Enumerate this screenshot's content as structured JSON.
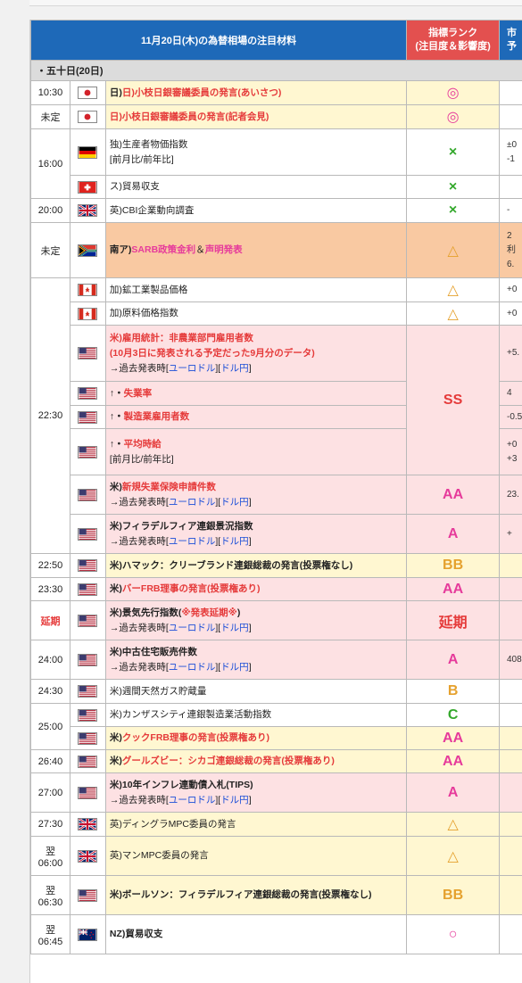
{
  "header": {
    "title": "11月20日(木)の為替相場の注目材料",
    "rank_line1": "指標ランク",
    "rank_line2": "(注目度＆影響度)",
    "forecast_line1": "市",
    "forecast_line2": "予"
  },
  "date_row": "・五十日(20日)",
  "rows": [
    {
      "time": "10:30",
      "flag": "jp-flag-icon",
      "lines": [
        "日)小枝日銀審議委員の発言(あいさつ)"
      ],
      "rank": "◎",
      "fc": [
        ""
      ]
    },
    {
      "time": "未定",
      "flag": "jp-flag-icon",
      "lines": [
        "日)小枝日銀審議委員の発言(記者会見)"
      ],
      "rank": "◎",
      "fc": [
        ""
      ]
    },
    {
      "time": "16:00",
      "flag": "de-flag-icon",
      "lines": [
        "独)生産者物価指数",
        "[前月比/前年比]"
      ],
      "rank": "×",
      "fc": [
        "±0",
        "-1"
      ]
    },
    {
      "time": "",
      "flag": "ch-flag-icon",
      "lines": [
        "ス)貿易収支"
      ],
      "rank": "×",
      "fc": [
        ""
      ]
    },
    {
      "time": "20:00",
      "flag": "uk-flag-icon",
      "lines": [
        "英)CBI企業動向調査"
      ],
      "rank": "×",
      "fc": [
        "-"
      ]
    },
    {
      "time": "未定",
      "flag": "za-flag-icon",
      "lines": [
        "南ア)",
        "SARB政策金利",
        "＆",
        "声明発表"
      ],
      "rank": "△",
      "fc": [
        "2",
        "利",
        "6."
      ]
    },
    {
      "time": "22:30",
      "flag": "ca-flag-icon",
      "lines": [
        "加)鉱工業製品価格"
      ],
      "rank": "△",
      "fc": [
        "+0"
      ]
    },
    {
      "time": "",
      "flag": "ca-flag-icon",
      "lines": [
        "加)原料価格指数"
      ],
      "rank": "△",
      "fc": [
        "+0"
      ]
    },
    {
      "time": "",
      "flag": "us-flag-icon",
      "lines": [
        "米)雇用統計：非農業部門雇用者数",
        "(10月3日に発表される予定だった9月分のデータ)",
        "→過去発表時[",
        "ユーロドル",
        "][",
        "ドル円",
        "]"
      ],
      "rank": "SS",
      "fc": [
        "+5."
      ]
    },
    {
      "time": "",
      "flag": "us-flag-icon",
      "lines": [
        "↑・",
        "失業率"
      ],
      "rank": "",
      "fc": [
        "4"
      ]
    },
    {
      "time": "",
      "flag": "us-flag-icon",
      "lines": [
        "↑・",
        "製造業雇用者数"
      ],
      "rank": "",
      "fc": [
        "-0.5"
      ]
    },
    {
      "time": "",
      "flag": "us-flag-icon",
      "lines": [
        "↑・",
        "平均時給",
        "[前月比/前年比]"
      ],
      "rank": "",
      "fc": [
        "+0",
        "+3"
      ]
    },
    {
      "time": "",
      "flag": "us-flag-icon",
      "lines": [
        "米)",
        "新規失業保険申請件数",
        "→過去発表時[",
        "ユーロドル",
        "][",
        "ドル円",
        "]"
      ],
      "rank": "AA",
      "fc": [
        "23."
      ]
    },
    {
      "time": "",
      "flag": "us-flag-icon",
      "lines": [
        "米)フィラデルフィア連銀景況指数",
        "→過去発表時[",
        "ユーロドル",
        "][",
        "ドル円",
        "]"
      ],
      "rank": "A",
      "fc": [
        "+"
      ]
    },
    {
      "time": "22:50",
      "flag": "us-flag-icon",
      "lines": [
        "米)ハマック：クリーブランド連銀総裁の発言(投票権なし)"
      ],
      "rank": "BB",
      "fc": [
        ""
      ]
    },
    {
      "time": "23:30",
      "flag": "us-flag-icon",
      "lines": [
        "米)",
        "バーFRB理事の発言(投票権あり)"
      ],
      "rank": "AA",
      "fc": [
        ""
      ]
    },
    {
      "time": "延期",
      "flag": "us-flag-icon",
      "lines": [
        "米)景気先行指数(",
        "※発表延期※",
        ")",
        "→過去発表時[",
        "ユーロドル",
        "][",
        "ドル円",
        "]"
      ],
      "rank": "延期",
      "fc": [
        ""
      ]
    },
    {
      "time": "24:00",
      "flag": "us-flag-icon",
      "lines": [
        "米)中古住宅販売件数",
        "→過去発表時[",
        "ユーロドル",
        "][",
        "ドル円",
        "]"
      ],
      "rank": "A",
      "fc": [
        "408"
      ]
    },
    {
      "time": "24:30",
      "flag": "us-flag-icon",
      "lines": [
        "米)週間天然ガス貯蔵量"
      ],
      "rank": "B",
      "fc": [
        ""
      ]
    },
    {
      "time": "25:00",
      "flag": "us-flag-icon",
      "lines": [
        "米)カンザスシティ連銀製造業活動指数"
      ],
      "rank": "C",
      "fc": [
        ""
      ]
    },
    {
      "time": "",
      "flag": "us-flag-icon",
      "lines": [
        "米)",
        "クックFRB理事の発言(投票権あり)"
      ],
      "rank": "AA",
      "fc": [
        ""
      ]
    },
    {
      "time": "26:40",
      "flag": "us-flag-icon",
      "lines": [
        "米)",
        "グールズビー：シカゴ連銀総裁の発言(投票権あり)"
      ],
      "rank": "AA",
      "fc": [
        ""
      ]
    },
    {
      "time": "27:00",
      "flag": "us-flag-icon",
      "lines": [
        "米)10年インフレ連動債入札(TIPS)",
        "→過去発表時[",
        "ユーロドル",
        "][",
        "ドル円",
        "]"
      ],
      "rank": "A",
      "fc": [
        ""
      ]
    },
    {
      "time": "27:30",
      "flag": "uk-flag-icon",
      "lines": [
        "英)ディングラMPC委員の発言"
      ],
      "rank": "△",
      "fc": [
        ""
      ]
    },
    {
      "time1": "翌",
      "time": "06:00",
      "flag": "uk-flag-icon",
      "lines": [
        "英)マンMPC委員の発言"
      ],
      "rank": "△",
      "fc": [
        ""
      ]
    },
    {
      "time1": "翌",
      "time": "06:30",
      "flag": "us-flag-icon",
      "lines": [
        "米)ボールソン：フィラデルフィア連銀総裁の発言(投票権なし)"
      ],
      "rank": "BB",
      "fc": [
        ""
      ]
    },
    {
      "time1": "翌",
      "time": "06:45",
      "flag": "nz-flag-icon",
      "lines": [
        "NZ)貿易収支"
      ],
      "rank": "○",
      "fc": [
        ""
      ]
    }
  ],
  "colors": {
    "header_blue": "#1e69b8",
    "rank_header_red": "#e3504f",
    "row_yellow": "#fff7d1",
    "row_pink": "#fde1e3",
    "row_orange": "#f9c9a2",
    "rank_pink": "#e63b9b",
    "rank_orange": "#e5a12e",
    "rank_green": "#34a82c",
    "link_blue": "#1c4fd8",
    "alert_red": "#e53a3a"
  }
}
